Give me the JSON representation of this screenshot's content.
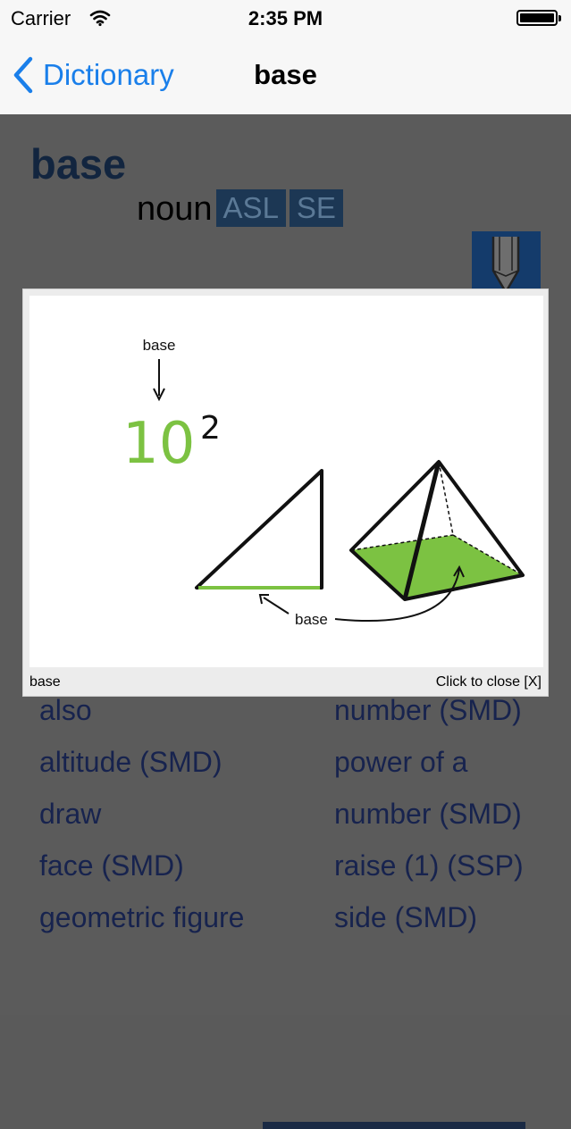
{
  "status_bar": {
    "carrier": "Carrier",
    "time": "2:35 PM"
  },
  "navbar": {
    "back_label": "Dictionary",
    "title": "base"
  },
  "entry": {
    "word": "base",
    "part_of_speech": "noun",
    "tags": [
      "ASL",
      "SE"
    ]
  },
  "related_terms": {
    "column1": [
      "also",
      "altitude (SMD)",
      "draw",
      "face (SMD)",
      "geometric figure"
    ],
    "column2": [
      "number (SMD)",
      "power of a",
      "number (SMD)",
      "raise (1) (SSP)",
      "side (SMD)"
    ]
  },
  "popup": {
    "caption": "base",
    "close_label": "Click to close [X]",
    "illustration": {
      "top_label": "base",
      "base_number": "10",
      "exponent": "2",
      "shape_label": "base"
    }
  },
  "colors": {
    "accent_blue": "#1a7fea",
    "green": "#7cc242",
    "tag_bg": "#1c3754"
  }
}
